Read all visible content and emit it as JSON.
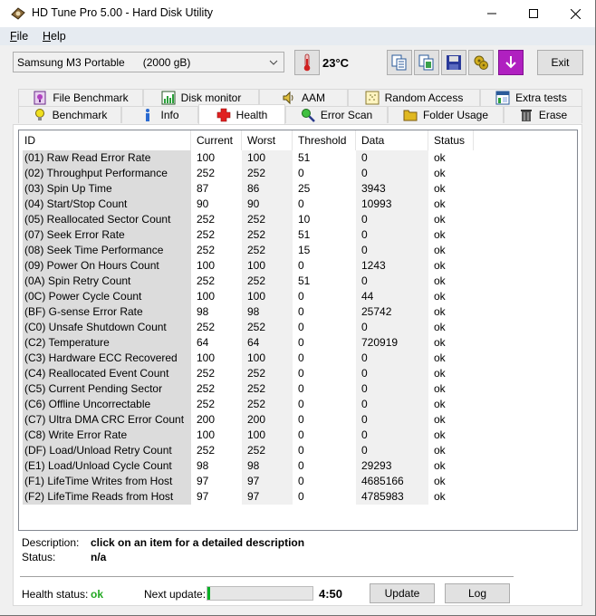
{
  "window": {
    "title": "HD Tune Pro 5.00 - Hard Disk Utility",
    "controls": [
      "minimize",
      "maximize",
      "close"
    ]
  },
  "menu": [
    {
      "label": "File",
      "accel": "F",
      "rest": "ile"
    },
    {
      "label": "Help",
      "accel": "H",
      "rest": "elp"
    }
  ],
  "toolbar": {
    "drive": "Samsung M3 Portable      (2000 gB)",
    "temperature": "23°C",
    "icons": [
      "thermometer-icon",
      "copy-info-icon",
      "copy-screenshot-icon",
      "save-icon",
      "options-icon",
      "download-icon"
    ],
    "exit_label": "Exit"
  },
  "tabs": {
    "top": [
      {
        "label": "File Benchmark",
        "icon": "file-benchmark-icon"
      },
      {
        "label": "Disk monitor",
        "icon": "disk-monitor-icon"
      },
      {
        "label": "AAM",
        "icon": "speaker-icon"
      },
      {
        "label": "Random Access",
        "icon": "random-access-icon"
      },
      {
        "label": "Extra tests",
        "icon": "extra-tests-icon"
      }
    ],
    "bottom": [
      {
        "label": "Benchmark",
        "icon": "lightbulb-icon"
      },
      {
        "label": "Info",
        "icon": "info-icon"
      },
      {
        "label": "Health",
        "icon": "health-cross-icon",
        "active": true
      },
      {
        "label": "Error Scan",
        "icon": "magnifier-icon"
      },
      {
        "label": "Folder Usage",
        "icon": "folder-icon"
      },
      {
        "label": "Erase",
        "icon": "trash-icon"
      }
    ]
  },
  "table": {
    "columns": [
      "ID",
      "Current",
      "Worst",
      "Threshold",
      "Data",
      "Status"
    ],
    "rows": [
      [
        "(01) Raw Read Error Rate",
        "100",
        "100",
        "51",
        "0",
        "ok"
      ],
      [
        "(02) Throughput Performance",
        "252",
        "252",
        "0",
        "0",
        "ok"
      ],
      [
        "(03) Spin Up Time",
        "87",
        "86",
        "25",
        "3943",
        "ok"
      ],
      [
        "(04) Start/Stop Count",
        "90",
        "90",
        "0",
        "10993",
        "ok"
      ],
      [
        "(05) Reallocated Sector Count",
        "252",
        "252",
        "10",
        "0",
        "ok"
      ],
      [
        "(07) Seek Error Rate",
        "252",
        "252",
        "51",
        "0",
        "ok"
      ],
      [
        "(08) Seek Time Performance",
        "252",
        "252",
        "15",
        "0",
        "ok"
      ],
      [
        "(09) Power On Hours Count",
        "100",
        "100",
        "0",
        "1243",
        "ok"
      ],
      [
        "(0A) Spin Retry Count",
        "252",
        "252",
        "51",
        "0",
        "ok"
      ],
      [
        "(0C) Power Cycle Count",
        "100",
        "100",
        "0",
        "44",
        "ok"
      ],
      [
        "(BF) G-sense Error Rate",
        "98",
        "98",
        "0",
        "25742",
        "ok"
      ],
      [
        "(C0) Unsafe Shutdown Count",
        "252",
        "252",
        "0",
        "0",
        "ok"
      ],
      [
        "(C2) Temperature",
        "64",
        "64",
        "0",
        "720919",
        "ok"
      ],
      [
        "(C3) Hardware ECC Recovered",
        "100",
        "100",
        "0",
        "0",
        "ok"
      ],
      [
        "(C4) Reallocated Event Count",
        "252",
        "252",
        "0",
        "0",
        "ok"
      ],
      [
        "(C5) Current Pending Sector",
        "252",
        "252",
        "0",
        "0",
        "ok"
      ],
      [
        "(C6) Offline Uncorrectable",
        "252",
        "252",
        "0",
        "0",
        "ok"
      ],
      [
        "(C7) Ultra DMA CRC Error Count",
        "200",
        "200",
        "0",
        "0",
        "ok"
      ],
      [
        "(C8) Write Error Rate",
        "100",
        "100",
        "0",
        "0",
        "ok"
      ],
      [
        "(DF) Load/Unload Retry Count",
        "252",
        "252",
        "0",
        "0",
        "ok"
      ],
      [
        "(E1) Load/Unload Cycle Count",
        "98",
        "98",
        "0",
        "29293",
        "ok"
      ],
      [
        "(F1) LifeTime Writes from Host",
        "97",
        "97",
        "0",
        "4685166",
        "ok"
      ],
      [
        "(F2) LifeTime Reads from Host",
        "97",
        "97",
        "0",
        "4785983",
        "ok"
      ]
    ]
  },
  "details": {
    "description_label": "Description:",
    "description_value": "click on an item for a detailed description",
    "status_label": "Status:",
    "status_value": "n/a"
  },
  "footer": {
    "health_label": "Health status:",
    "health_value": "ok",
    "health_color": "#22a822",
    "next_update_label": "Next update:",
    "next_update_progress": 0.03,
    "countdown": "4:50",
    "update_label": "Update",
    "log_label": "Log"
  }
}
